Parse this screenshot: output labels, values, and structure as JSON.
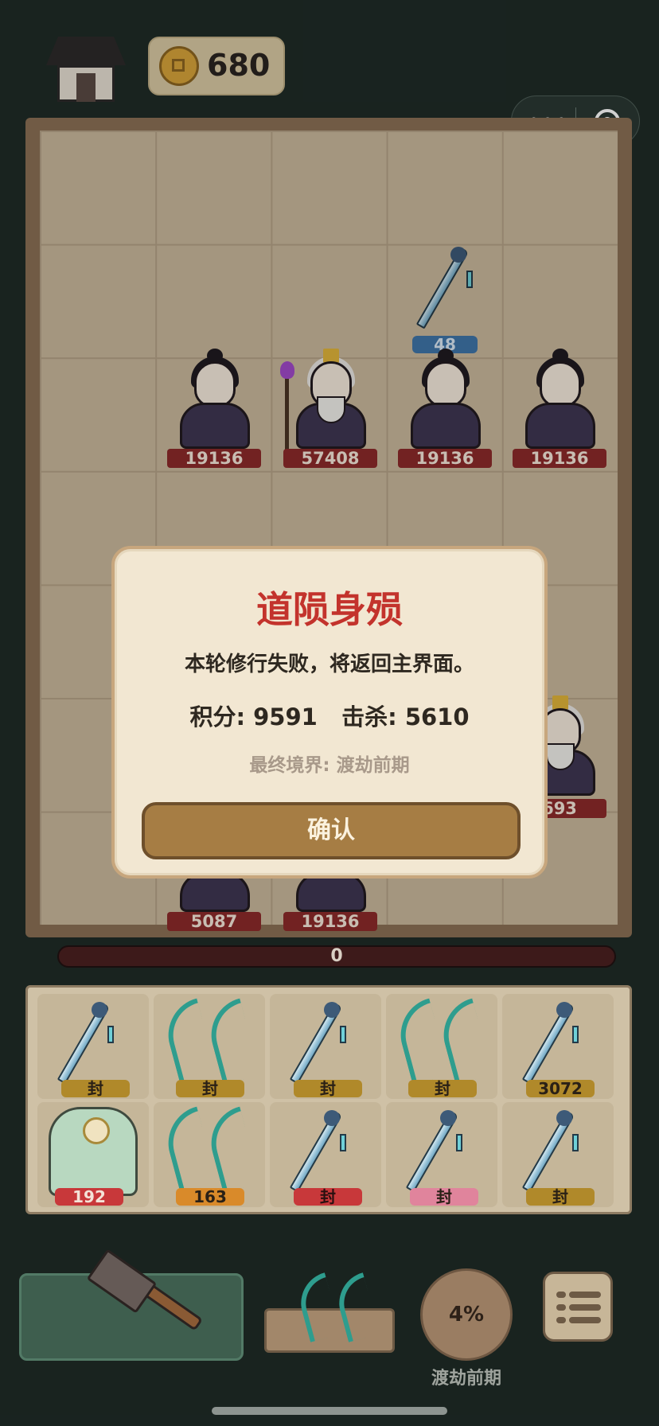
{
  "top_bar": {
    "coins": "680",
    "house_icon": "house-icon",
    "coin_icon": "coin-icon"
  },
  "board": {
    "sword_level": "48",
    "units_row1": [
      "19136",
      "57408",
      "19136",
      "19136"
    ],
    "right_unit": "693",
    "units_bottom": [
      "5087",
      "19136"
    ]
  },
  "progress": {
    "value": "0"
  },
  "inventory": {
    "row1": [
      "封",
      "封",
      "封",
      "封",
      "3072"
    ],
    "row2": [
      "192",
      "163",
      "封",
      "封",
      "封"
    ],
    "level_colors": [
      "#b0892a",
      "#b0892a",
      "#b0892a",
      "#b0892a",
      "#b0892a",
      "#c8383a",
      "#d98a2a",
      "#c8383a",
      "#e0849c",
      "#b0892a"
    ]
  },
  "bottom": {
    "realm_percent": "4%",
    "realm_name": "渡劫前期"
  },
  "modal": {
    "title": "道陨身殒",
    "message": "本轮修行失败，将返回主界面。",
    "stats": "积分: 9591   击杀: 5610",
    "realm": "最终境界: 渡劫前期",
    "confirm": "确认"
  }
}
